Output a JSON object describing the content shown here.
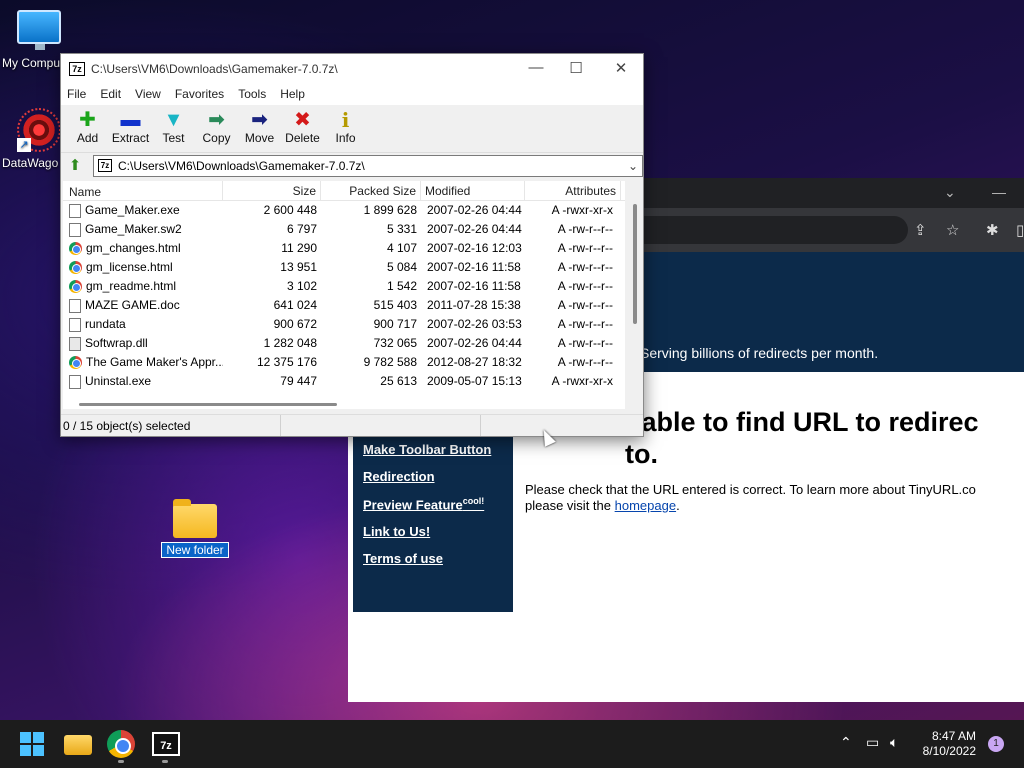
{
  "desktop": {
    "icons": [
      {
        "label": "My Compu",
        "icon": "monitor-icon"
      },
      {
        "label": "DataWago",
        "icon": "datawagon-icon"
      }
    ],
    "new_folder": {
      "label": "New folder",
      "icon": "folder-icon"
    }
  },
  "browser": {
    "tagline": "Serving billions of redirects per month.",
    "sidebar_links": [
      "Make Toolbar Button",
      "Redirection",
      "Preview Feature",
      "Link to Us!",
      "Terms of use"
    ],
    "preview_sup": "cool!",
    "heading": "nable to find URL to redirec to.",
    "message_1": "Please check that the URL entered is correct. To learn more about TinyURL.co",
    "message_2": "please visit the",
    "link": "homepage",
    "message_end": "."
  },
  "sevenzip": {
    "app_icon": "7z",
    "title": "C:\\Users\\VM6\\Downloads\\Gamemaker-7.0.7z\\",
    "menu": [
      "File",
      "Edit",
      "View",
      "Favorites",
      "Tools",
      "Help"
    ],
    "toolbar": [
      {
        "label": "Add",
        "icon": "add-icon",
        "glyph": "✚",
        "color": "#1aa51a"
      },
      {
        "label": "Extract",
        "icon": "extract-icon",
        "glyph": "▬",
        "color": "#1133cc"
      },
      {
        "label": "Test",
        "icon": "test-icon",
        "glyph": "▼",
        "color": "#19b5c5"
      },
      {
        "label": "Copy",
        "icon": "copy-icon",
        "glyph": "➡",
        "color": "#2a8a5a"
      },
      {
        "label": "Move",
        "icon": "move-icon",
        "glyph": "➡",
        "color": "#1a237e"
      },
      {
        "label": "Delete",
        "icon": "delete-icon",
        "glyph": "✖",
        "color": "#d41a1a"
      },
      {
        "label": "Info",
        "icon": "info-icon",
        "glyph": "i",
        "color": "#b59a00"
      }
    ],
    "path": "C:\\Users\\VM6\\Downloads\\Gamemaker-7.0.7z\\",
    "columns": [
      "Name",
      "Size",
      "Packed Size",
      "Modified",
      "Attributes"
    ],
    "files": [
      {
        "name": "Game_Maker.exe",
        "size": "2 600 448",
        "packed": "1 899 628",
        "modified": "2007-02-26 04:44",
        "attr": "A -rwxr-xr-x",
        "icon": "file"
      },
      {
        "name": "Game_Maker.sw2",
        "size": "6 797",
        "packed": "5 331",
        "modified": "2007-02-26 04:44",
        "attr": "A -rw-r--r--",
        "icon": "file"
      },
      {
        "name": "gm_changes.html",
        "size": "11 290",
        "packed": "4 107",
        "modified": "2007-02-16 12:03",
        "attr": "A -rw-r--r--",
        "icon": "chrome"
      },
      {
        "name": "gm_license.html",
        "size": "13 951",
        "packed": "5 084",
        "modified": "2007-02-16 11:58",
        "attr": "A -rw-r--r--",
        "icon": "chrome"
      },
      {
        "name": "gm_readme.html",
        "size": "3 102",
        "packed": "1 542",
        "modified": "2007-02-16 11:58",
        "attr": "A -rw-r--r--",
        "icon": "chrome"
      },
      {
        "name": "MAZE GAME.doc",
        "size": "641 024",
        "packed": "515 403",
        "modified": "2011-07-28 15:38",
        "attr": "A -rw-r--r--",
        "icon": "file"
      },
      {
        "name": "rundata",
        "size": "900 672",
        "packed": "900 717",
        "modified": "2007-02-26 03:53",
        "attr": "A -rw-r--r--",
        "icon": "file"
      },
      {
        "name": "Softwrap.dll",
        "size": "1 282 048",
        "packed": "732 065",
        "modified": "2007-02-26 04:44",
        "attr": "A -rw-r--r--",
        "icon": "dll"
      },
      {
        "name": "The Game Maker's Appr...",
        "size": "12 375 176",
        "packed": "9 782 588",
        "modified": "2012-08-27 18:32",
        "attr": "A -rw-r--r--",
        "icon": "chrome"
      },
      {
        "name": "Uninstal.exe",
        "size": "79 447",
        "packed": "25 613",
        "modified": "2009-05-07 15:13",
        "attr": "A -rwxr-xr-x",
        "icon": "file"
      }
    ],
    "status": "0 / 15 object(s) selected"
  },
  "taskbar": {
    "apps": [
      "start",
      "file-explorer",
      "chrome",
      "7-zip"
    ],
    "app_7z_label": "7z",
    "time": "8:47 AM",
    "date": "8/10/2022",
    "notifications": "1"
  }
}
